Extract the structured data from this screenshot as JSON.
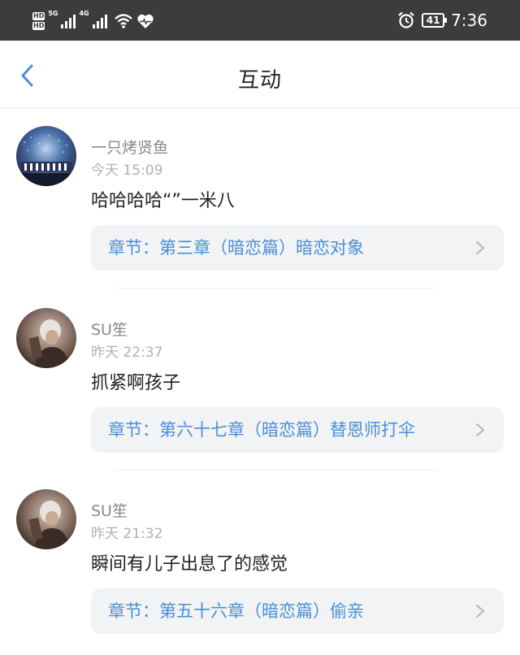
{
  "status_bar": {
    "hd_top": "HD",
    "hd_bottom": "HD",
    "net1": "5G",
    "net2": "4G",
    "battery": "41",
    "time": "7:36",
    "icons": [
      "signal-icon",
      "wifi-icon",
      "heart-pulse-icon",
      "alarm-icon",
      "battery-icon"
    ]
  },
  "header": {
    "title": "互动",
    "back_icon": "chevron-left-icon"
  },
  "colors": {
    "status_bar_bg": "#3c3c3c",
    "accent_blue": "#4a8fd6",
    "chapter_bg": "#f2f3f5"
  },
  "comments": [
    {
      "user": "一只烤贤鱼",
      "time": "今天 15:09",
      "text": "哈哈哈哈“”一米八",
      "chapter": "章节：第三章（暗恋篇）暗恋对象",
      "avatar": "stadium-night-avatar"
    },
    {
      "user": "SU笙",
      "time": "昨天 22:37",
      "text": "抓紧啊孩子",
      "chapter": "章节：第六十七章（暗恋篇）替恩师打伞",
      "avatar": "person-portrait-avatar"
    },
    {
      "user": "SU笙",
      "time": "昨天 21:32",
      "text": "瞬间有儿子出息了的感觉",
      "chapter": "章节：第五十六章（暗恋篇）偷亲",
      "avatar": "person-portrait-avatar"
    }
  ]
}
